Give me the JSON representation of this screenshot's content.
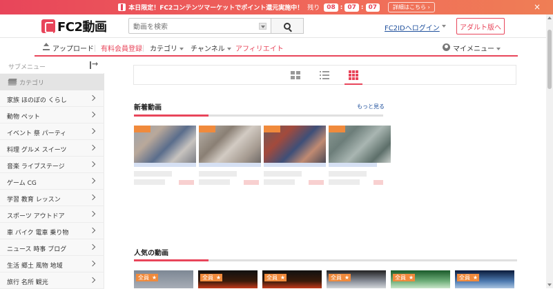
{
  "promo": {
    "text": "本日限定！FC2コンテンツマーケットでポイント還元実施中！",
    "remaining_label": "残り",
    "hours": "08",
    "minutes": "07",
    "seconds": "07",
    "details_label": "詳細はこちら ›",
    "close_label": "×"
  },
  "header": {
    "logo_text": "FC2動画",
    "search_placeholder": "動画を検索",
    "login_label": "FC2IDへログイン",
    "adult_label": "アダルト版へ"
  },
  "nav": {
    "upload": "アップロード",
    "paid_member": "有料会員登録",
    "category": "カテゴリ",
    "channel": "チャンネル",
    "affiliate": "アフィリエイト",
    "my_menu": "マイメニュー"
  },
  "sidebar": {
    "submenu_label": "サブメニュー",
    "category_label": "カテゴリ",
    "items": [
      "家族 ほのぼの くらし",
      "動物 ペット",
      "イベント 祭 パーティ",
      "料理 グルメ スイーツ",
      "音楽 ライブステージ",
      "ゲーム CG",
      "学習 教育 レッスン",
      "スポーツ アウトドア",
      "車 バイク 電車 乗り物",
      "ニュース 時事 ブログ",
      "生活 郷土 風物 地域",
      "旅行 名所 観光"
    ]
  },
  "main": {
    "new_videos_title": "新着動画",
    "more_label": "もっと見る",
    "popular_title": "人気の動画",
    "popular_badge": "全員",
    "star": "★"
  },
  "colors": {
    "accent": "#e8455a",
    "link": "#1e4f9c",
    "badge": "#f08a3c"
  }
}
